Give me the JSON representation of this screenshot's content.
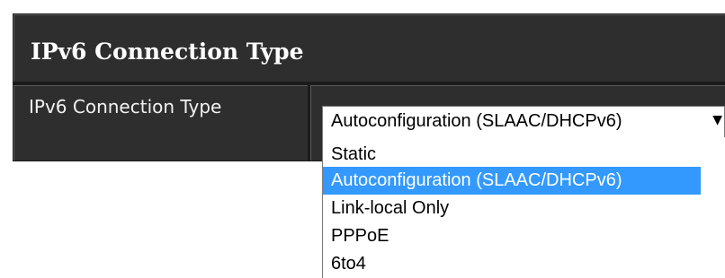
{
  "panel": {
    "title": "IPv6 Connection Type"
  },
  "field": {
    "label": "IPv6 Connection Type",
    "selected_value": "Autoconfiguration (SLAAC/DHCPv6)",
    "arrow_icon": "triangle-down"
  },
  "dropdown": {
    "options": [
      {
        "label": "Static",
        "selected": false
      },
      {
        "label": "Autoconfiguration (SLAAC/DHCPv6)",
        "selected": true
      },
      {
        "label": "Link-local Only",
        "selected": false
      },
      {
        "label": "PPPoE",
        "selected": false
      },
      {
        "label": "6to4",
        "selected": false
      }
    ],
    "highlight_color": "#3399ff"
  }
}
